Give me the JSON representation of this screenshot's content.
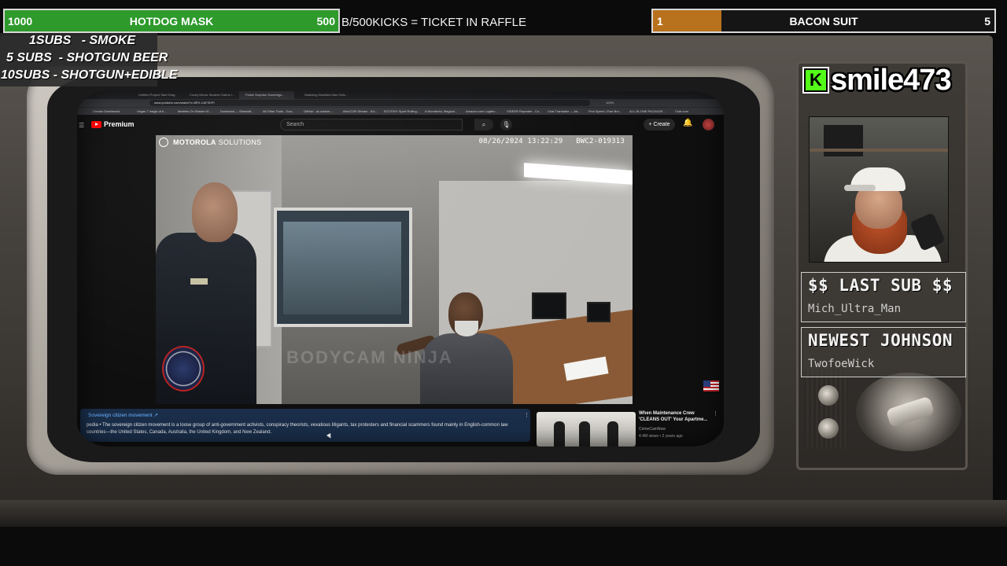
{
  "colors": {
    "left_goal_fill": "#2e9a2c",
    "right_goal_fill": "#b8711d",
    "kick_green": "#53fc18",
    "youtube_red": "#ff0000",
    "info_panel_bg": "#1a2e4a",
    "info_link": "#6ab4ff"
  },
  "overlay": {
    "left_goal": {
      "current": "1000",
      "label": "HOTDOG MASK",
      "target": "500",
      "progress": 1.0
    },
    "ticker": "B/500KICKS = TICKET IN RAFFLE",
    "right_goal": {
      "current": "1",
      "label": "BACON SUIT",
      "target": "5",
      "progress": 0.2
    },
    "sub_rewards": [
      "1SUBS   - SMOKE",
      "5 SUBS  - SHOTGUN BEER",
      "10SUBS - SHOTGUN+EDIBLE"
    ],
    "kick_logo_letter": "K",
    "streamer_name": "smile473",
    "last_sub": {
      "title": "$$ LAST SUB $$",
      "name": "Mich_Ultra_Man"
    },
    "newest": {
      "title": "NEWEST JOHNSON",
      "name": "TwofoeWick"
    }
  },
  "browser": {
    "tabs": [
      {
        "label": "Untitled Project Start Drag"
      },
      {
        "label": "Cocky Illinois Student Claims I..."
      },
      {
        "label": "Police Surprise Sovereign..."
      },
      {
        "label": "Watching Disabled Man Gets..."
      }
    ],
    "active_tab_index": 2,
    "url": "www.youtube.com/watch?v=8RX-CAFZKPI",
    "zoom": "100%",
    "bookmarks": [
      "Creator Dashboard",
      "Vegan 7 magic of b...",
      "Marbles On Stream Vi...",
      "Download — Stream8...",
      "All Other Tools - Goo...",
      "GitHub - ai-custom-...",
      "AlexC199 Stream - Kic...",
      "ECOTINY Sport Rolling...",
      "A Wonderful, Magical...",
      "Amazon.com Logitec...",
      "VIDEER Repeater - Co...",
      "Chat Translator — Ad...",
      "Find Speed | Fast Bro...",
      "ALL-IN-ONE PACKAGE...",
      "Club.com"
    ]
  },
  "youtube": {
    "logo_word": "Premium",
    "search_placeholder": "Search",
    "create_label": "Create",
    "video": {
      "brand": "MOTOROLA",
      "brand_suffix": "SOLUTIONS",
      "timestamp": "08/26/2024 13:22:29",
      "camera_id": "BWC2-019313",
      "watermark": "BODYCAM NINJA"
    },
    "info_panel": {
      "title": "Sovereign citizen movement ↗",
      "text": "pedia • The sovereign citizen movement is a loose group of anti-government activists, conspiracy theorists, vexatious litigants, tax protesters and financial scammers found mainly in English-common law countries—the United States, Canada, Australia, the United Kingdom, and New Zealand."
    },
    "recommended": {
      "title": "When Maintenance Crew 'CLEANS OUT' Your Apartme...",
      "channel": "CrimeCamNow",
      "views": "4.4M views • 2 years ago"
    }
  }
}
